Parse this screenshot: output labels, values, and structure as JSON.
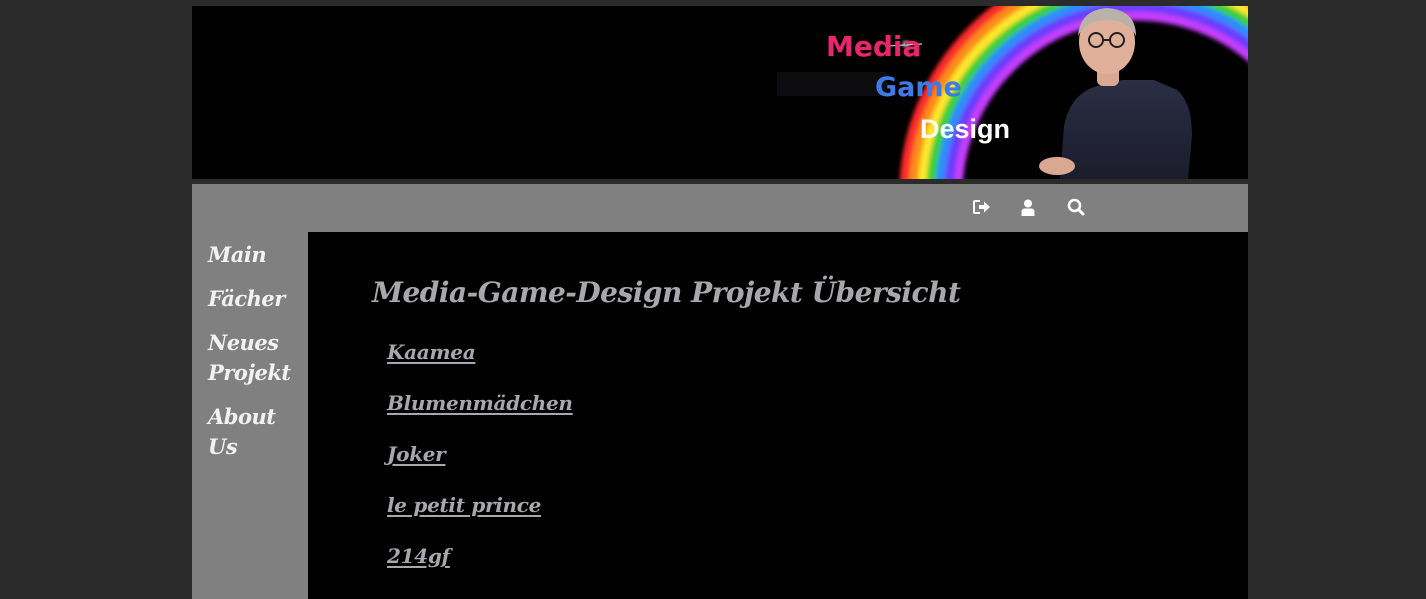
{
  "banner": {
    "brand_media": "Media",
    "brand_game": "Game",
    "brand_design": "Design",
    "colors": {
      "media": "#e8266e",
      "game": "#3e7be8",
      "design": "#ffffff"
    }
  },
  "toolbar": {
    "icons": [
      "logout-icon",
      "user-icon",
      "search-icon"
    ]
  },
  "sidebar": {
    "items": [
      {
        "label": "Main"
      },
      {
        "label": "Fächer"
      },
      {
        "label": "Neues Projekt"
      },
      {
        "label": "About Us"
      }
    ]
  },
  "main": {
    "title": "Media-Game-Design Projekt Übersicht",
    "projects": [
      {
        "label": "Kaamea"
      },
      {
        "label": "Blumenmädchen"
      },
      {
        "label": "Joker"
      },
      {
        "label": "le petit prince"
      },
      {
        "label": "214gf"
      }
    ]
  },
  "colors": {
    "page_bg": "#2b2b2b",
    "bar_gray": "#808080",
    "content_bg": "#000000",
    "link_text": "#a8a8ac"
  }
}
